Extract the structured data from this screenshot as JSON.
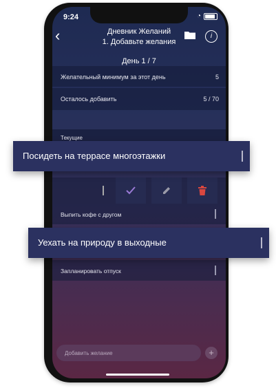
{
  "status": {
    "time": "9:24"
  },
  "header": {
    "title": "Дневник Желаний",
    "subtitle": "1. Добавьте желания",
    "day": "День 1 / 7"
  },
  "stats": [
    {
      "label": "Желательный минимум за этот день",
      "value": "5"
    },
    {
      "label": "Осталось добавить",
      "value": "5 / 70"
    }
  ],
  "section": {
    "label": "Текущие"
  },
  "floating_cards": [
    {
      "text": "Посидеть на террасе многоэтажки"
    },
    {
      "text": "Уехать на природу в выходные"
    }
  ],
  "items": [
    {
      "text": "Выпить кофе с другом"
    },
    {
      "text": "Запланировать отпуск"
    }
  ],
  "actions": {
    "icons": [
      "check-icon",
      "pencil-icon",
      "trash-icon"
    ],
    "check_color": "#9a7ad6",
    "pencil_color": "#9a9aa8",
    "trash_color": "#d9473f"
  },
  "input": {
    "placeholder": "Добавить желание"
  }
}
